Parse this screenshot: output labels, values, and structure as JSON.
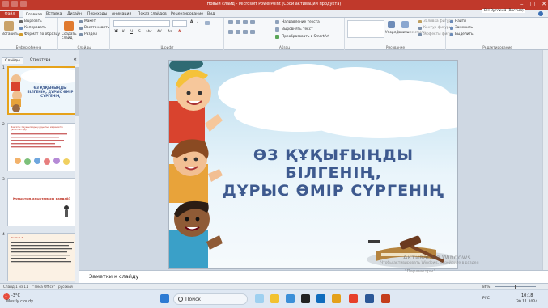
{
  "window": {
    "title": "Новый слайд - Microsoft PowerPoint (Сбой активации продукта)",
    "controls": [
      "–",
      "□",
      "✕"
    ]
  },
  "ribbon_tabs": [
    {
      "label": "Файл"
    },
    {
      "label": "Главная"
    },
    {
      "label": "Вставка"
    },
    {
      "label": "Дизайн"
    },
    {
      "label": "Переходы"
    },
    {
      "label": "Анимация"
    },
    {
      "label": "Показ слайдов"
    },
    {
      "label": "Рецензирование"
    },
    {
      "label": "Вид"
    }
  ],
  "ribbon": {
    "clipboard": {
      "paste": "Вставить",
      "cut": "Вырезать",
      "copy": "Копировать",
      "format": "Формат по образцу",
      "group": "Буфер обмена"
    },
    "slides": {
      "new_slide": "Создать слайд",
      "layout": "Макет",
      "reset": "Восстановить",
      "section": "Раздел",
      "group": "Слайды"
    },
    "font": {
      "group": "Шрифт",
      "bold": "Ж",
      "italic": "К",
      "underline": "Ч",
      "strike": "S",
      "shadow": "abc",
      "spacing": "AV",
      "case": "Aa",
      "color": "A",
      "grow": "A",
      "shrink": "A"
    },
    "paragraph": {
      "text_direction": "Направление текста",
      "align_text": "Выровнять текст",
      "smartart": "Преобразовать в SmartArt",
      "group": "Абзац"
    },
    "drawing": {
      "arrange": "Упорядочить",
      "quick_styles": "Экспресс-стили",
      "fill": "Заливка фигуры",
      "outline": "Контур фигуры",
      "effects": "Эффекты фигур",
      "group": "Рисование"
    },
    "editing": {
      "find": "Найти",
      "replace": "Заменить",
      "select": "Выделить",
      "group": "Редактирование"
    },
    "language": "RU Русский (Россия)"
  },
  "left_panel": {
    "tabs": [
      "Слайды",
      "Структура"
    ],
    "close": "×",
    "thumbnails": [
      {
        "number": "1",
        "title": "ӨЗ ҚҰҚЫҒЫҢДЫ БІЛГЕНІҢ, ДҰРЫС ӨМІР СҮРГЕНІҢ"
      },
      {
        "number": "2",
        "title": "Мақсаты: Оқушылардың құқықтық мәдениетін қалыптастыру"
      },
      {
        "number": "3",
        "title": "Құқықтың анықтамасы қандай?"
      },
      {
        "number": "4",
        "title": "Жазба 1-3"
      }
    ]
  },
  "slide": {
    "title_line1": "ӨЗ ҚҰҚЫҒЫҢДЫ БІЛГЕНІҢ,",
    "title_line2": "ДҰРЫС ӨМІР СҮРГЕНІҢ",
    "title_color": "#3e5a8f"
  },
  "notes_placeholder": "Заметки к слайду",
  "status": {
    "slide_info": "Слайд 1 из 11",
    "theme": "\"Тема Office\"",
    "language": "русский",
    "zoom": "86%"
  },
  "watermark": {
    "line1": "Активация Windows",
    "line2": "Чтобы активировать Windows, перейдите в раздел",
    "line3": "\"Параметры\"."
  },
  "taskbar": {
    "weather_temp": "-3°C",
    "weather_desc": "Mostly cloudy",
    "search_placeholder": "Поиск",
    "lang": "РУС",
    "time": "10:18",
    "date": "30.11.2024",
    "notification_count": "1"
  }
}
